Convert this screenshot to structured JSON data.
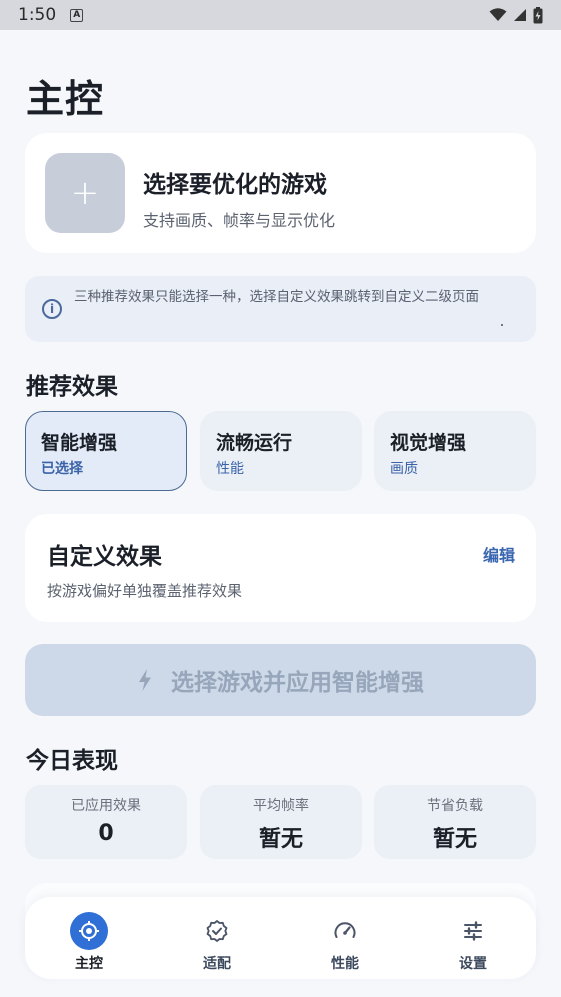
{
  "status_bar": {
    "time": "1:50",
    "notification_glyph": "A",
    "icons": [
      "wifi-icon",
      "signal-icon",
      "battery-icon"
    ]
  },
  "header": {
    "title": "主控"
  },
  "game_select": {
    "title": "选择要优化的游戏",
    "subtitle": "支持画质、帧率与显示优化",
    "add_glyph": "+"
  },
  "info": {
    "glyph": "i",
    "text": "三种推荐效果只能选择一种，选择自定义效果跳转到自定义二级页面"
  },
  "recommended": {
    "title": "推荐效果",
    "presets": [
      {
        "name": "智能增强",
        "tag": "已选择",
        "selected": true
      },
      {
        "name": "流畅运行",
        "tag": "性能",
        "selected": false
      },
      {
        "name": "视觉增强",
        "tag": "画质",
        "selected": false
      }
    ]
  },
  "custom": {
    "title": "自定义效果",
    "subtitle": "按游戏偏好单独覆盖推荐效果",
    "edit_label": "编辑"
  },
  "apply_button": {
    "label": "选择游戏并应用智能增强",
    "enabled": false
  },
  "today": {
    "title": "今日表现",
    "stats": [
      {
        "label": "已应用效果",
        "value": "0"
      },
      {
        "label": "平均帧率",
        "value": "暂无"
      },
      {
        "label": "节省负载",
        "value": "暂无"
      }
    ]
  },
  "nav": {
    "items": [
      {
        "label": "主控",
        "icon": "target-icon",
        "active": true
      },
      {
        "label": "适配",
        "icon": "badge-check-icon",
        "active": false
      },
      {
        "label": "性能",
        "icon": "speedometer-icon",
        "active": false
      },
      {
        "label": "设置",
        "icon": "sliders-icon",
        "active": false
      }
    ]
  },
  "colors": {
    "accent": "#2f6fd6",
    "link": "#3a66b0",
    "selected_border": "#4d6a93",
    "disabled_button": "#cdd9e8"
  }
}
